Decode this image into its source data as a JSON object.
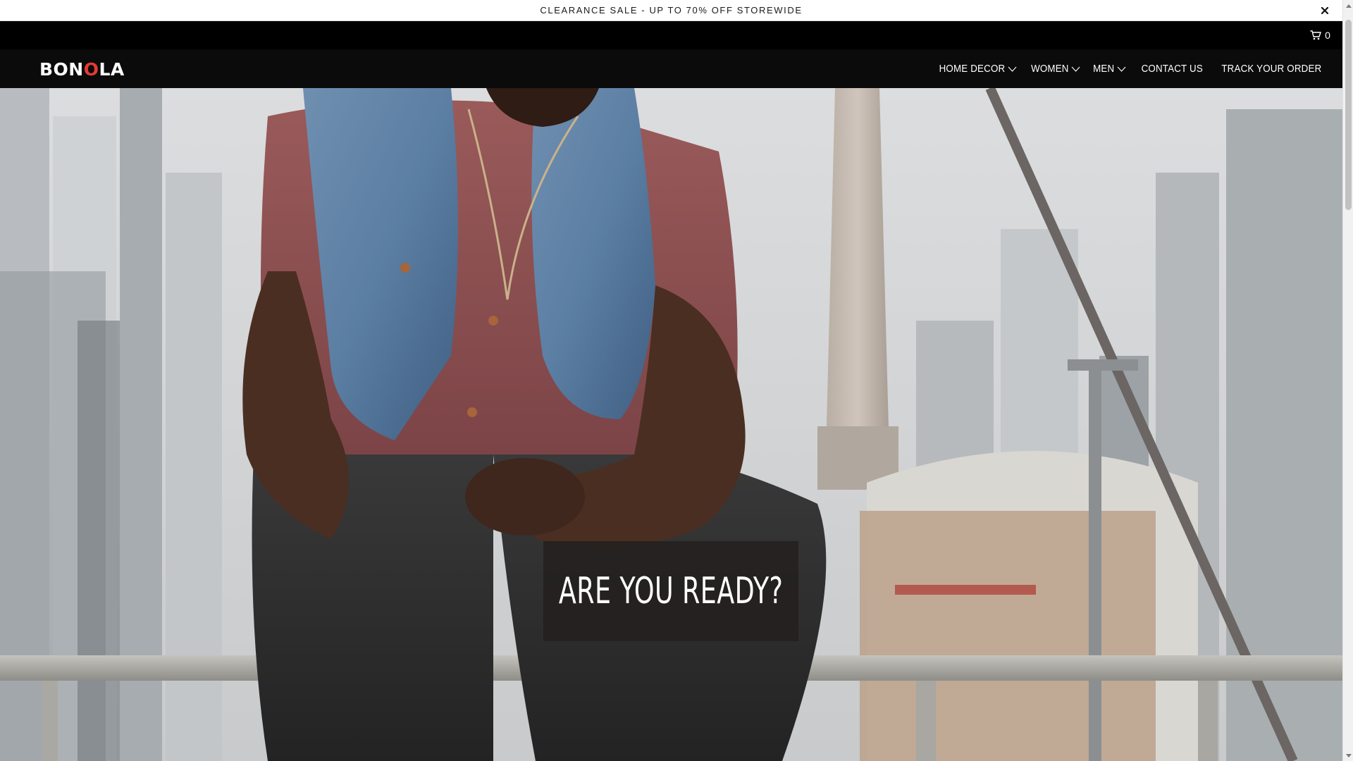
{
  "announcement": {
    "text": "CLEARANCE SALE - UP TO 70% OFF STOREWIDE",
    "close_icon": "close-icon"
  },
  "topbar": {
    "cart_icon": "cart-icon",
    "cart_count": "0"
  },
  "navbar": {
    "logo": {
      "part1": "BON",
      "part2": "O",
      "part3": "LA"
    },
    "menu": [
      {
        "label": "HOME DECOR",
        "has_dropdown": true
      },
      {
        "label": "WOMEN",
        "has_dropdown": true
      },
      {
        "label": "MEN",
        "has_dropdown": true
      },
      {
        "label": "CONTACT US",
        "has_dropdown": false
      },
      {
        "label": "TRACK YOUR ORDER",
        "has_dropdown": false
      }
    ]
  },
  "hero": {
    "title": "ARE YOU READY?"
  },
  "colors": {
    "accent": "#e23b33",
    "nav_background": "#0b0b0b",
    "topbar_background": "#000000",
    "caption_background": "#23201e"
  }
}
